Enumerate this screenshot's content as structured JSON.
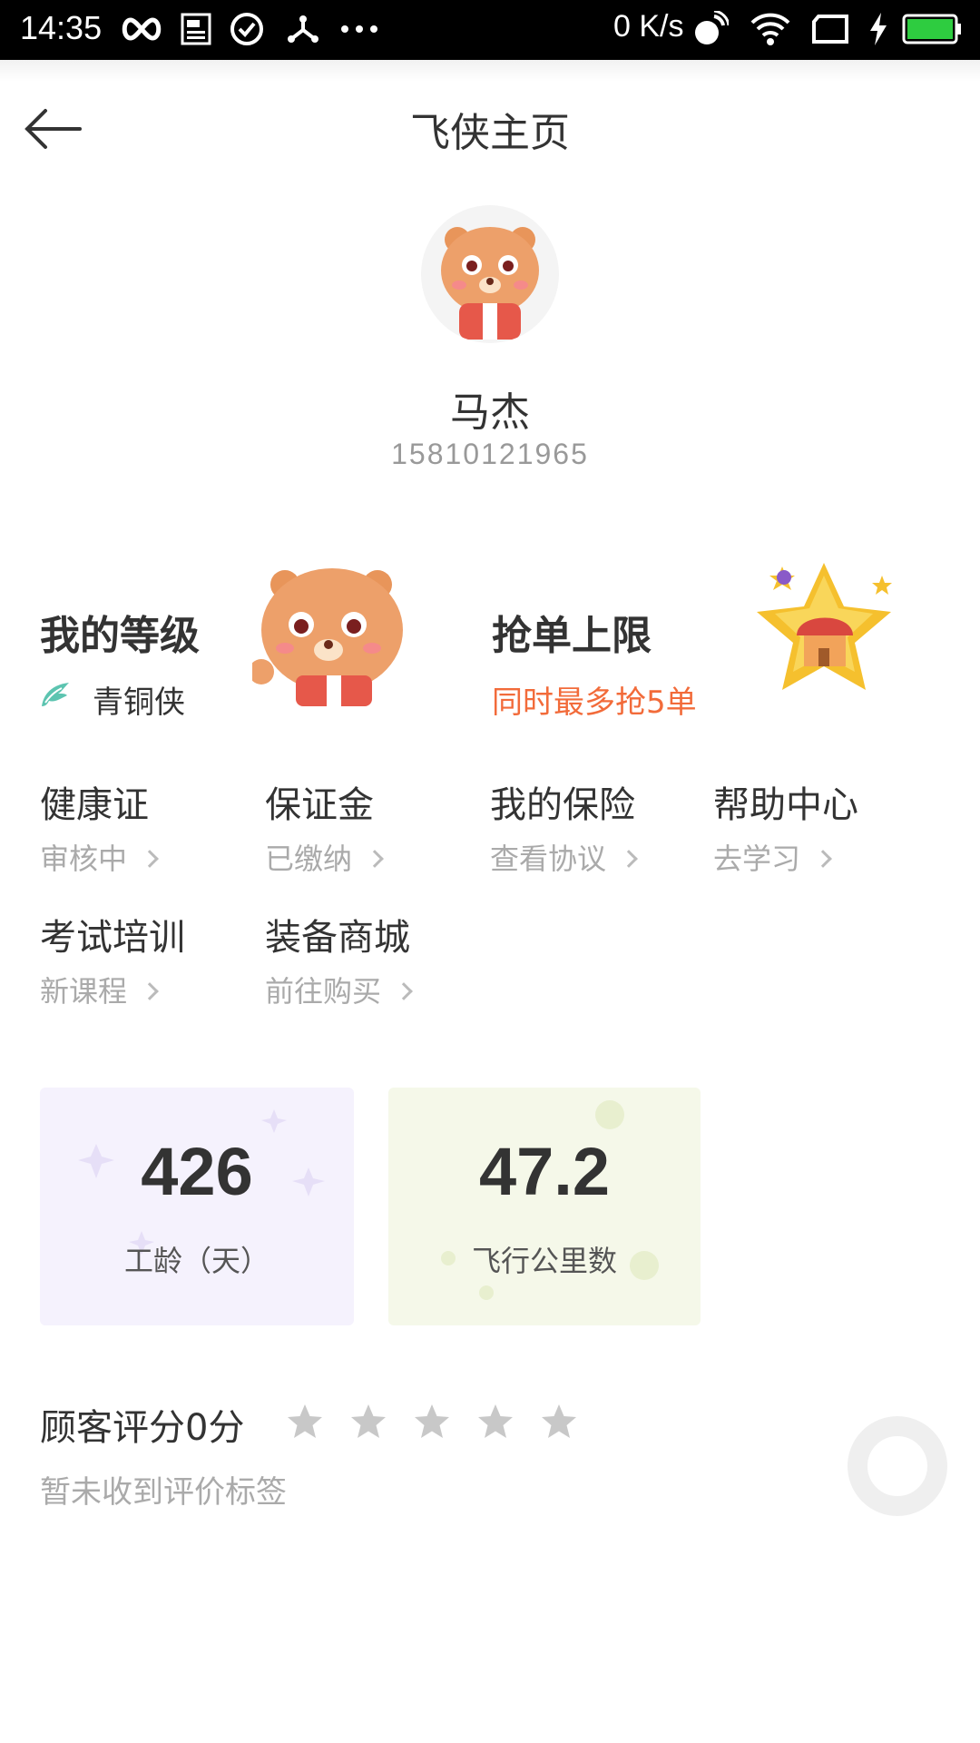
{
  "status_bar": {
    "time": "14:35",
    "speed": "0 K/s",
    "icons": [
      "infinity-icon",
      "notes-icon",
      "check-circle-icon",
      "share-icon",
      "more-dots-icon",
      "nfc-icon",
      "wifi-icon",
      "screen-icon",
      "charging-icon",
      "battery-icon"
    ]
  },
  "header": {
    "title": "飞侠主页",
    "back_icon": "back-arrow-icon"
  },
  "profile": {
    "name": "马杰",
    "phone": "15810121965"
  },
  "level_card": {
    "title": "我的等级",
    "level": "青铜侠"
  },
  "grab_card": {
    "title": "抢单上限",
    "limit_text": "同时最多抢5单",
    "accent_color": "#f26b3a"
  },
  "features": [
    {
      "label": "健康证",
      "sub": "审核中"
    },
    {
      "label": "保证金",
      "sub": "已缴纳"
    },
    {
      "label": "我的保险",
      "sub": "查看协议"
    },
    {
      "label": "帮助中心",
      "sub": "去学习"
    },
    {
      "label": "考试培训",
      "sub": "新课程"
    },
    {
      "label": "装备商城",
      "sub": "前往购买"
    }
  ],
  "stats": {
    "tenure": {
      "value": "426",
      "label": "工龄（天）",
      "bg": "#f5f2fd"
    },
    "distance": {
      "value": "47.2",
      "label": "飞行公里数",
      "bg": "#f5f8e9"
    }
  },
  "rating": {
    "label": "顾客评分0分",
    "stars_filled": 0,
    "stars_total": 5,
    "no_tags": "暂未收到评价标签"
  }
}
